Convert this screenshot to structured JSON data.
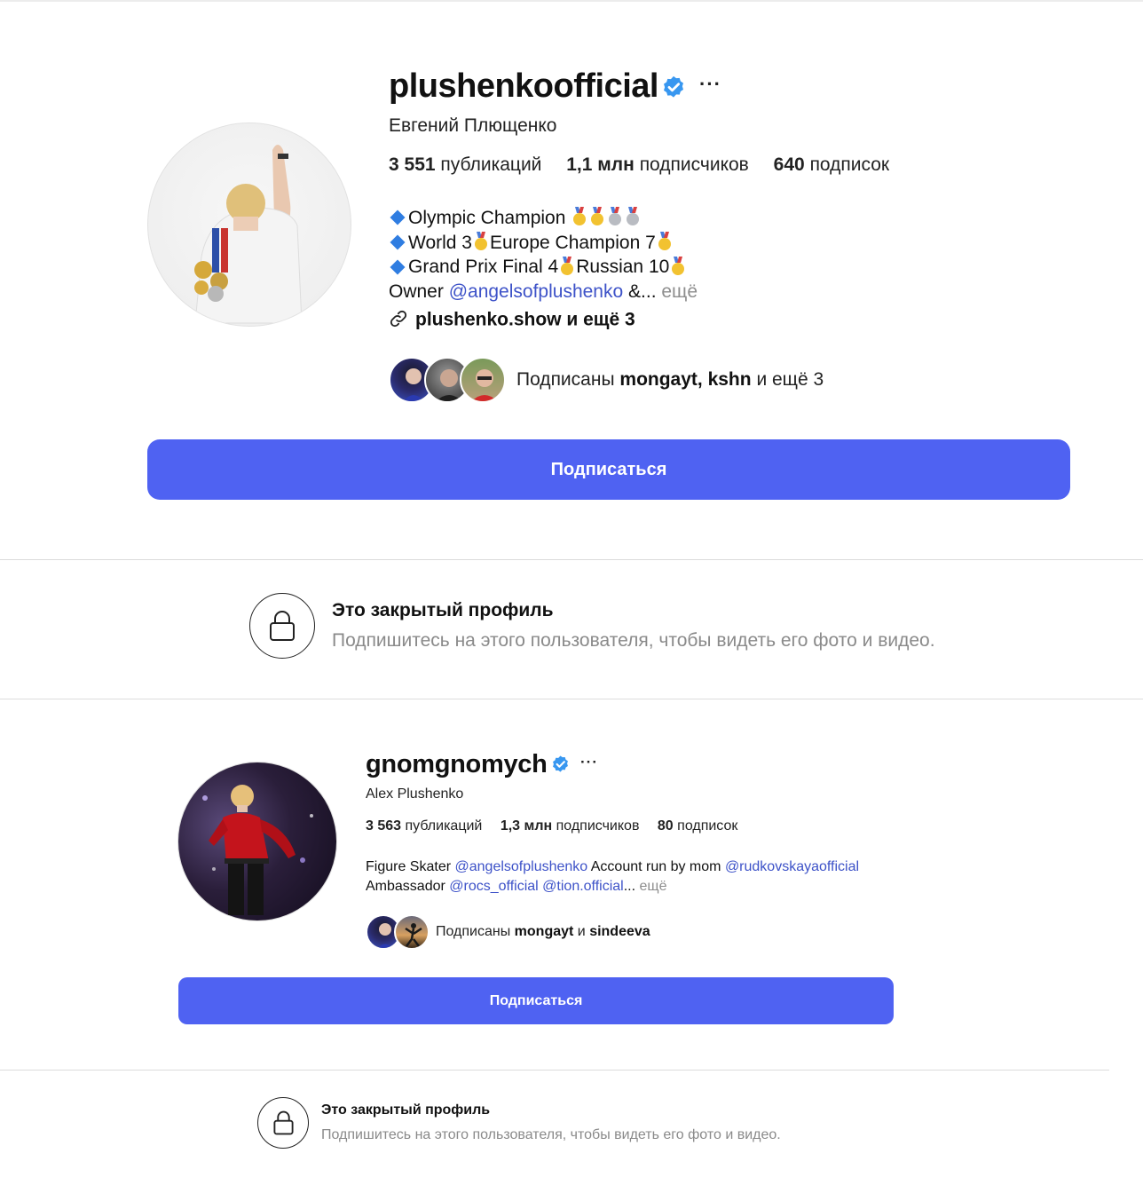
{
  "profile1": {
    "username": "plushenkoofficial",
    "verified_icon": "verified-badge-icon",
    "more_label": "···",
    "full_name": "Евгений Плющенко",
    "stats": {
      "posts_value": "3 551",
      "posts_label": "публикаций",
      "followers_value": "1,1 млн",
      "followers_label": "подписчиков",
      "following_value": "640",
      "following_label": "подписок"
    },
    "bio": {
      "line1": "Olympic Champion",
      "line2_a": "World 3",
      "line2_b": "Europe Champion 7",
      "line3_a": "Grand Prix Final 4",
      "line3_b": "Russian 10",
      "line4_prefix": "Owner",
      "line4_mention": "@angelsofplushenko",
      "line4_suffix": "&...",
      "more": "ещё"
    },
    "link": "plushenko.show и ещё 3",
    "followed_by": {
      "prefix": "Подписаны",
      "names": "mongayt, kshn",
      "suffix": "и ещё 3"
    },
    "follow_button": "Подписаться"
  },
  "private1": {
    "title": "Это закрытый профиль",
    "subtitle": "Подпишитесь на этого пользователя, чтобы видеть его фото и видео."
  },
  "profile2": {
    "username": "gnomgnomych",
    "more_label": "···",
    "full_name": "Alex Plushenko",
    "stats": {
      "posts_value": "3 563",
      "posts_label": "публикаций",
      "followers_value": "1,3 млн",
      "followers_label": "подписчиков",
      "following_value": "80",
      "following_label": "подписок"
    },
    "bio": {
      "line1_a": "Figure Skater",
      "line1_mention1": "@angelsofplushenko",
      "line1_b": "Account run by mom",
      "line1_mention2": "@rudkovskayaofficial",
      "line2_a": "Ambassador",
      "line2_mention1": "@rocs_official",
      "line2_mention2": "@tion.official",
      "line2_suffix": "...",
      "more": "ещё"
    },
    "followed_by": {
      "prefix": "Подписаны",
      "name1": "mongayt",
      "and": "и",
      "name2": "sindeeva"
    },
    "follow_button": "Подписаться"
  },
  "private2": {
    "title": "Это закрытый профиль",
    "subtitle": "Подпишитесь на этого пользователя, чтобы видеть его фото и видео."
  },
  "colors": {
    "accent": "#4f62f2",
    "mention": "#3d52c8",
    "verified": "#3897f0",
    "muted": "#8e8e8e"
  }
}
